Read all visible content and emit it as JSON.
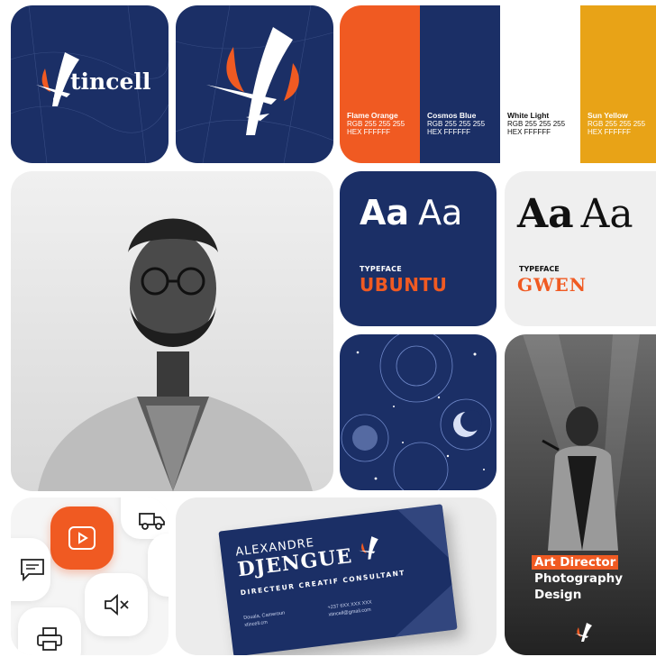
{
  "brand": {
    "logo_wordmark": "tincell"
  },
  "palette": [
    {
      "name": "Flame Orange",
      "rgb": "RGB 255 255 255",
      "hex": "HEX FFFFFF",
      "color": "#f05a22",
      "text_color": "#ffffff"
    },
    {
      "name": "Cosmos Blue",
      "rgb": "RGB 255 255 255",
      "hex": "HEX FFFFFF",
      "color": "#1b2f66",
      "text_color": "#ffffff"
    },
    {
      "name": "White Light",
      "rgb": "RGB 255 255 255",
      "hex": "HEX FFFFFF",
      "color": "#ffffff",
      "text_color": "#111111"
    },
    {
      "name": "Sun Yellow",
      "rgb": "RGB 255 255 255",
      "hex": "HEX FFFFFF",
      "color": "#e8a317",
      "text_color": "#ffffff"
    }
  ],
  "typefaces": [
    {
      "sample_bold": "Aa",
      "sample_light": "Aa",
      "label": "TYPEFACE",
      "name": "UBUNTU"
    },
    {
      "sample_bold": "Aa",
      "sample_light": "Aa",
      "label": "TYPEFACE",
      "name": "GWEN"
    }
  ],
  "business_card": {
    "first_name": "ALEXANDRE",
    "last_name": "DJENGUE",
    "title": "DIRECTEUR CREATIF CONSULTANT",
    "city": "Douala, Cameroun",
    "website": "xtincell.cm",
    "phone": "+237 6XX XXX XXX",
    "email": "xtincell@gmail.com"
  },
  "roles": {
    "highlight": "Art Director",
    "line2": "Photography",
    "line3": "Design"
  },
  "colors": {
    "navy": "#1b2f66",
    "orange": "#f05a22",
    "yellow": "#e8a317"
  }
}
